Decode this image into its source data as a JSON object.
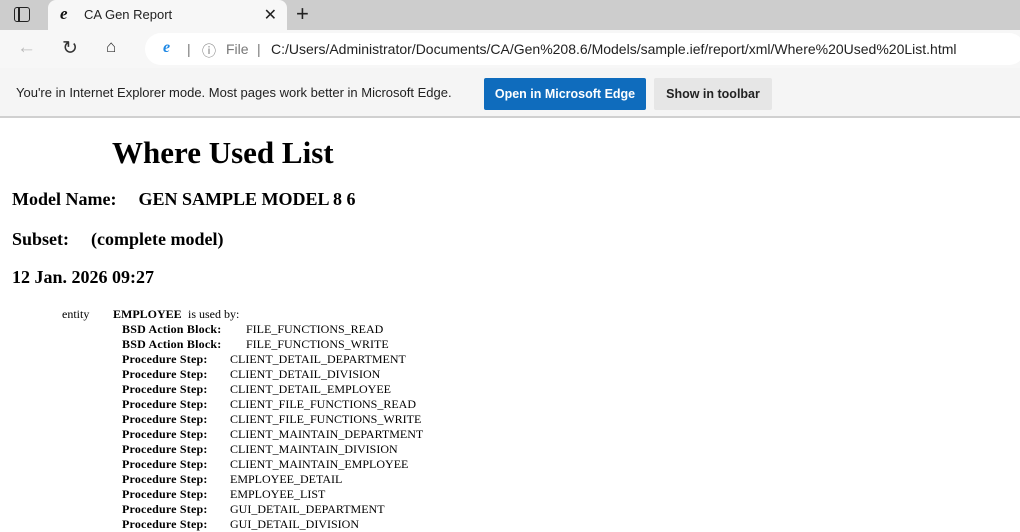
{
  "browser": {
    "tab_title": "CA Gen Report",
    "address_prefix": "File",
    "url": "C:/Users/Administrator/Documents/CA/Gen%208.6/Models/sample.ief/report/xml/Where%20Used%20List.html"
  },
  "iebar": {
    "message": "You're in Internet Explorer mode. Most pages work better in Microsoft Edge.",
    "open_edge": "Open in Microsoft Edge",
    "show_toolbar": "Show in toolbar"
  },
  "report": {
    "title": "Where Used List",
    "model_label": "Model Name:",
    "model_value": "GEN SAMPLE MODEL 8 6",
    "subset_label": "Subset:",
    "subset_value": "(complete model)",
    "date": "12 Jan. 2026 09:27",
    "entity_kind": "entity",
    "entity_name": "EMPLOYEE",
    "used_by": "is used by:",
    "rows": [
      {
        "type": "BSD Action Block:",
        "name": "FILE_FUNCTIONS_READ"
      },
      {
        "type": "BSD Action Block:",
        "name": "FILE_FUNCTIONS_WRITE"
      },
      {
        "type": "Procedure Step:",
        "name": "CLIENT_DETAIL_DEPARTMENT"
      },
      {
        "type": "Procedure Step:",
        "name": "CLIENT_DETAIL_DIVISION"
      },
      {
        "type": "Procedure Step:",
        "name": "CLIENT_DETAIL_EMPLOYEE"
      },
      {
        "type": "Procedure Step:",
        "name": "CLIENT_FILE_FUNCTIONS_READ"
      },
      {
        "type": "Procedure Step:",
        "name": "CLIENT_FILE_FUNCTIONS_WRITE"
      },
      {
        "type": "Procedure Step:",
        "name": "CLIENT_MAINTAIN_DEPARTMENT"
      },
      {
        "type": "Procedure Step:",
        "name": "CLIENT_MAINTAIN_DIVISION"
      },
      {
        "type": "Procedure Step:",
        "name": "CLIENT_MAINTAIN_EMPLOYEE"
      },
      {
        "type": "Procedure Step:",
        "name": "EMPLOYEE_DETAIL"
      },
      {
        "type": "Procedure Step:",
        "name": "EMPLOYEE_LIST"
      },
      {
        "type": "Procedure Step:",
        "name": "GUI_DETAIL_DEPARTMENT"
      },
      {
        "type": "Procedure Step:",
        "name": "GUI_DETAIL_DIVISION"
      }
    ]
  }
}
